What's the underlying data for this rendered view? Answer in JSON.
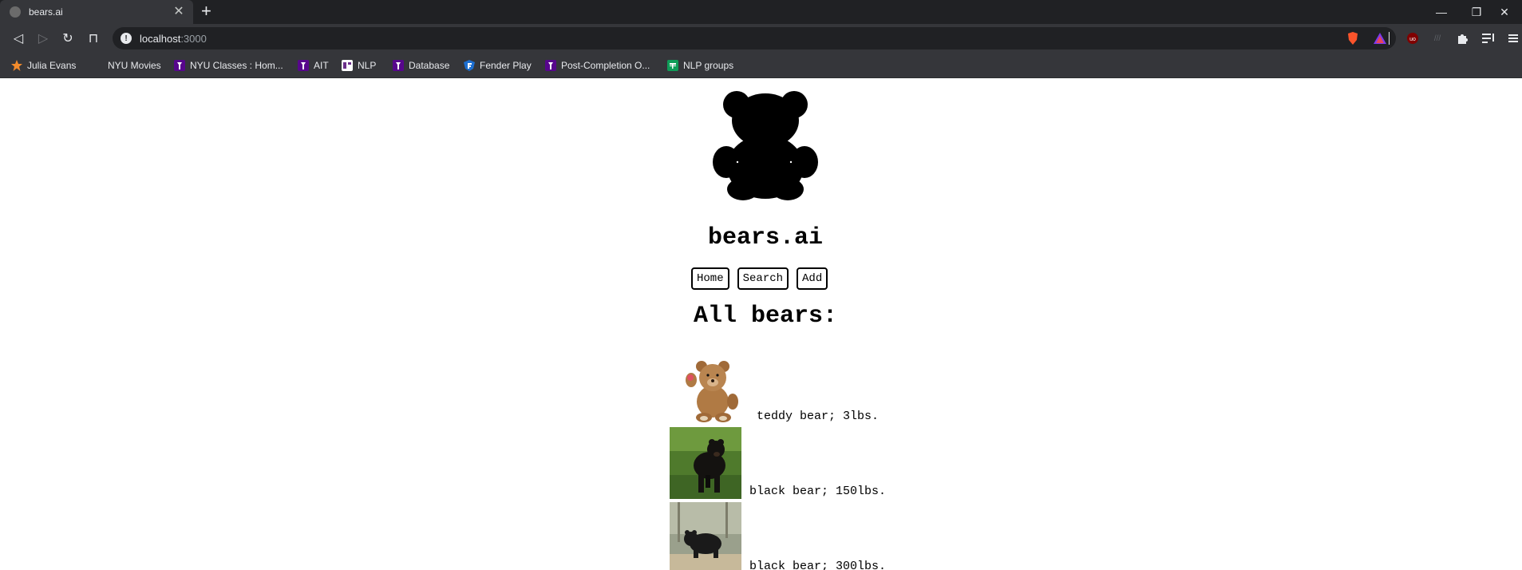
{
  "browser": {
    "tab": {
      "title": "bears.ai",
      "close_glyph": "✕"
    },
    "new_tab_glyph": "+",
    "window_controls": {
      "minimize": "—",
      "restore": "❐",
      "close": "✕"
    },
    "nav": {
      "back": "◁",
      "forward": "▷",
      "reload": "↻",
      "bookmark": "⊓"
    },
    "address": {
      "host": "localhost",
      "port": ":3000"
    },
    "bookmarks": [
      {
        "label": "Julia Evans",
        "icon": "star-icon",
        "color": "#f28b2c"
      },
      {
        "label": "NYU Movies",
        "icon": "",
        "color": ""
      },
      {
        "label": "NYU Classes : Hom...",
        "icon": "nyu-torch-icon",
        "color": "#57068c"
      },
      {
        "label": "AIT",
        "icon": "nyu-torch-icon",
        "color": "#57068c"
      },
      {
        "label": "NLP",
        "icon": "nlp-icon",
        "color": "#ffffff"
      },
      {
        "label": "Database",
        "icon": "nyu-torch-icon",
        "color": "#57068c"
      },
      {
        "label": "Fender Play",
        "icon": "fender-icon",
        "color": "#1d6fd1"
      },
      {
        "label": "Post-Completion O...",
        "icon": "nyu-torch-icon",
        "color": "#57068c"
      },
      {
        "label": "NLP groups",
        "icon": "sheets-icon",
        "color": "#0f9d58"
      }
    ]
  },
  "site": {
    "title": "bears.ai",
    "nav": [
      {
        "label": "Home"
      },
      {
        "label": "Search"
      },
      {
        "label": "Add"
      }
    ],
    "heading": "All bears:",
    "bears": [
      {
        "caption": "teddy bear; 3lbs.",
        "image": "teddy-bear-photo"
      },
      {
        "caption": "black bear; 150lbs.",
        "image": "black-bear-photo"
      },
      {
        "caption": "black bear; 300lbs.",
        "image": "black-bear-photo-2"
      }
    ]
  },
  "colors": {
    "chrome_dark": "#202124",
    "chrome": "#35363a",
    "page_bg": "#ffffff",
    "text": "#000000"
  }
}
